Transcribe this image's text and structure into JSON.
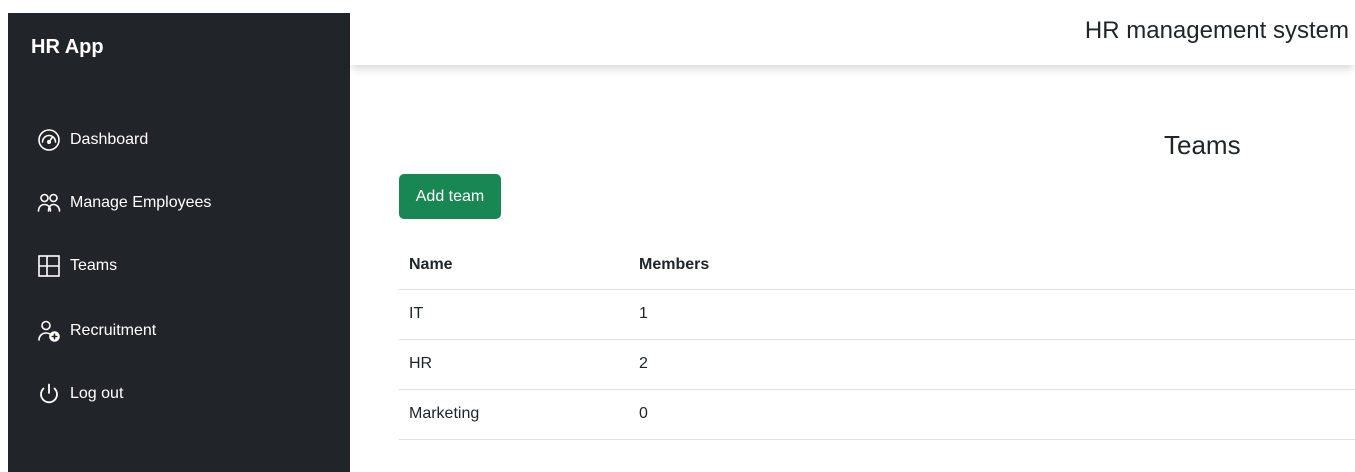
{
  "sidebar": {
    "brand": "HR App",
    "items": [
      {
        "label": "Dashboard",
        "icon": "speedometer-icon"
      },
      {
        "label": "Manage Employees",
        "icon": "people-icon"
      },
      {
        "label": "Teams",
        "icon": "layout-icon"
      },
      {
        "label": "Recruitment",
        "icon": "person-add-icon"
      },
      {
        "label": "Log out",
        "icon": "power-icon"
      }
    ]
  },
  "header": {
    "title": "HR management system"
  },
  "main": {
    "title": "Teams",
    "add_button": "Add team",
    "table": {
      "columns": [
        "Name",
        "Members"
      ],
      "rows": [
        {
          "name": "IT",
          "members": "1"
        },
        {
          "name": "HR",
          "members": "2"
        },
        {
          "name": "Marketing",
          "members": "0"
        }
      ]
    }
  },
  "colors": {
    "sidebar_bg": "#212529",
    "accent_green": "#198754",
    "text": "#212529"
  }
}
